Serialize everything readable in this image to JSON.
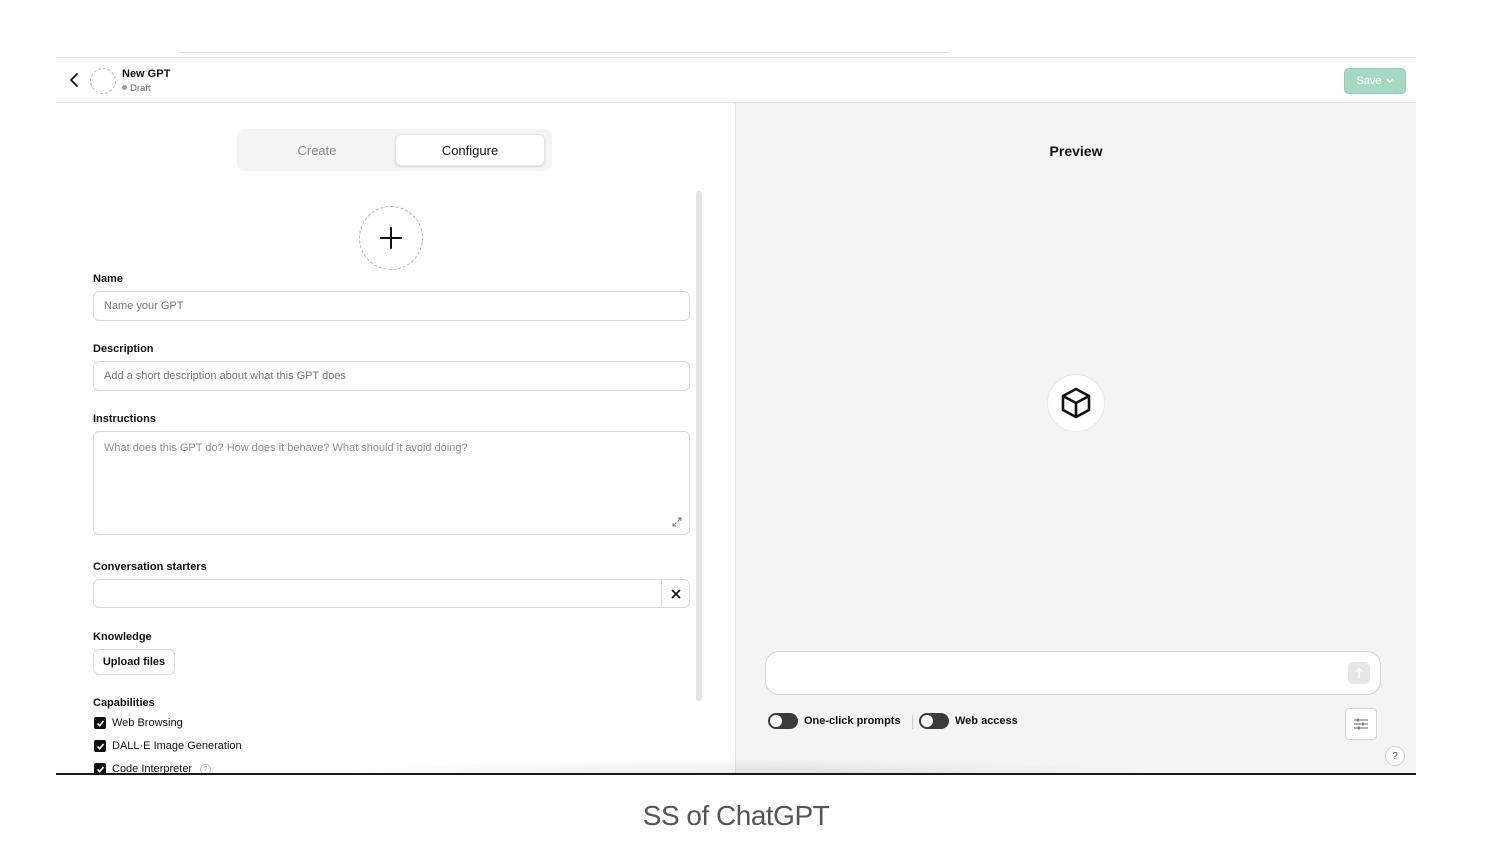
{
  "header": {
    "gpt_name": "New GPT",
    "status": "Draft",
    "save_label": "Save"
  },
  "tabs": [
    {
      "label": "Create",
      "active": false
    },
    {
      "label": "Configure",
      "active": true
    }
  ],
  "form": {
    "name_label": "Name",
    "name_placeholder": "Name your GPT",
    "description_label": "Description",
    "description_placeholder": "Add a short description about what this GPT does",
    "instructions_label": "Instructions",
    "instructions_placeholder": "What does this GPT do? How does it behave? What should it avoid doing?",
    "starters_label": "Conversation starters",
    "starters_value": "",
    "knowledge_label": "Knowledge",
    "upload_label": "Upload files",
    "capabilities_label": "Capabilities",
    "capabilities": [
      {
        "label": "Web Browsing",
        "checked": true
      },
      {
        "label": "DALL·E Image Generation",
        "checked": true
      },
      {
        "label": "Code Interpreter",
        "checked": true
      }
    ]
  },
  "preview": {
    "title": "Preview",
    "message_value": "",
    "toggles": [
      {
        "label": "One-click prompts",
        "on": false
      },
      {
        "label": "Web access",
        "on": false
      }
    ],
    "help_label": "?"
  },
  "caption": "SS of ChatGPT",
  "colors": {
    "save_bg": "#a7d8c4",
    "checkbox": "#111111",
    "preview_bg": "#f4f4f4"
  },
  "icons": {
    "back": "chevron-left-icon",
    "add_image": "plus-icon",
    "expand": "expand-icon",
    "remove_starter": "close-icon",
    "preview_avatar": "cube-icon",
    "send": "arrow-up-icon",
    "settings": "sliders-icon"
  }
}
